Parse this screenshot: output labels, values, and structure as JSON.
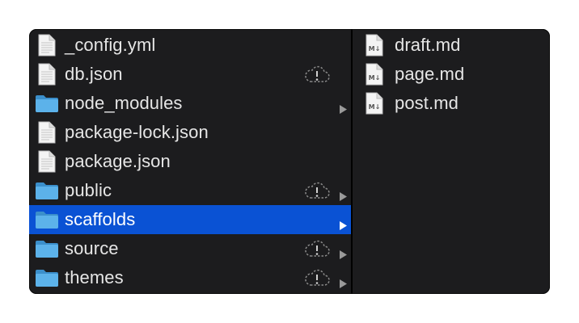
{
  "colors": {
    "window_bg": "#1c1c1e",
    "selection": "#0a52d4",
    "folder": "#4fa6e0",
    "text": "#e6e6e6"
  },
  "left_column": {
    "items": [
      {
        "name": "_config.yml",
        "icon": "document-icon",
        "cloud_alert": false,
        "has_children": false,
        "selected": false
      },
      {
        "name": "db.json",
        "icon": "document-icon",
        "cloud_alert": true,
        "has_children": false,
        "selected": false
      },
      {
        "name": "node_modules",
        "icon": "folder-icon",
        "cloud_alert": false,
        "has_children": true,
        "selected": false
      },
      {
        "name": "package-lock.json",
        "icon": "document-icon",
        "cloud_alert": false,
        "has_children": false,
        "selected": false
      },
      {
        "name": "package.json",
        "icon": "document-icon",
        "cloud_alert": false,
        "has_children": false,
        "selected": false
      },
      {
        "name": "public",
        "icon": "folder-icon",
        "cloud_alert": true,
        "has_children": true,
        "selected": false
      },
      {
        "name": "scaffolds",
        "icon": "folder-icon",
        "cloud_alert": false,
        "has_children": true,
        "selected": true
      },
      {
        "name": "source",
        "icon": "folder-icon",
        "cloud_alert": true,
        "has_children": true,
        "selected": false
      },
      {
        "name": "themes",
        "icon": "folder-icon",
        "cloud_alert": true,
        "has_children": true,
        "selected": false
      }
    ]
  },
  "right_column": {
    "items": [
      {
        "name": "draft.md",
        "icon": "markdown-file-icon"
      },
      {
        "name": "page.md",
        "icon": "markdown-file-icon"
      },
      {
        "name": "post.md",
        "icon": "markdown-file-icon"
      }
    ]
  }
}
